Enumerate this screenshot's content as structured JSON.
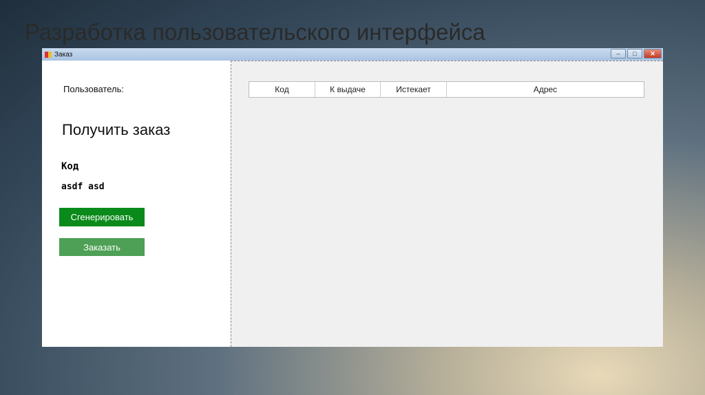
{
  "slide_title": "Разработка пользовательского интерфейса",
  "window": {
    "title": "Заказ"
  },
  "left": {
    "user_label": "Пользователь:",
    "heading": "Получить заказ",
    "code_label": "Код",
    "code_value": "asdf asd",
    "generate_button": "Сгенерировать",
    "order_button": "Заказать"
  },
  "grid": {
    "columns": [
      "Код",
      "К выдаче",
      "Истекает",
      "Адрес"
    ]
  }
}
